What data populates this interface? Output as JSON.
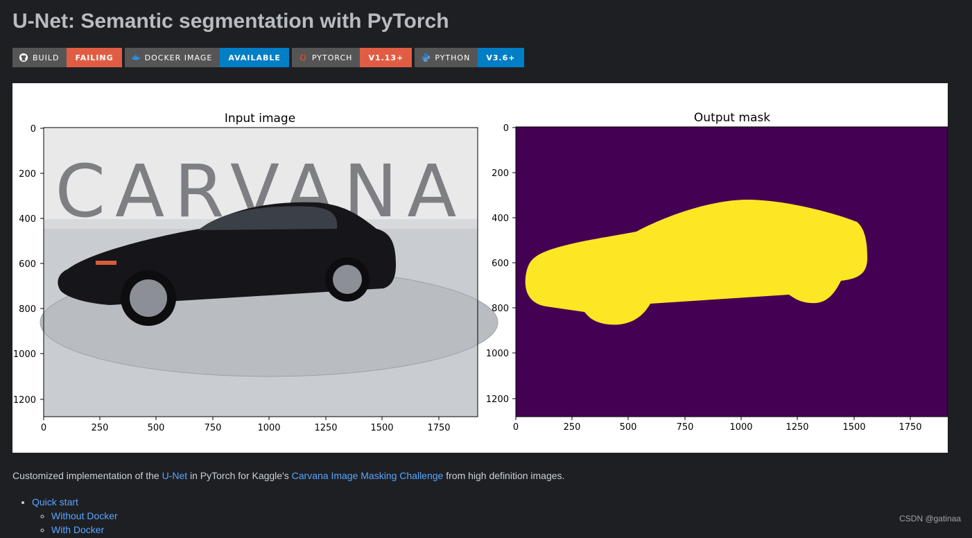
{
  "page": {
    "title": "U-Net: Semantic segmentation with PyTorch"
  },
  "badges": [
    {
      "label": "BUILD",
      "value": "FAILING",
      "icon": "github-icon",
      "color": "#e05d44"
    },
    {
      "label": "DOCKER IMAGE",
      "value": "AVAILABLE",
      "icon": "docker-icon",
      "color": "#007ec6"
    },
    {
      "label": "PYTORCH",
      "value": "V1.13+",
      "icon": "pytorch-icon",
      "color": "#e05d44"
    },
    {
      "label": "PYTHON",
      "value": "V3.6+",
      "icon": "python-icon",
      "color": "#007ec6"
    }
  ],
  "figure": {
    "left": {
      "title": "Input image",
      "watermark_text": "CARVANA",
      "xticks": [
        "0",
        "250",
        "500",
        "750",
        "1000",
        "1250",
        "1500",
        "1750"
      ],
      "yticks": [
        "0",
        "200",
        "400",
        "600",
        "800",
        "1000",
        "1200"
      ]
    },
    "right": {
      "title": "Output mask",
      "mask_color": "#fde725",
      "background_color": "#440154",
      "xticks": [
        "0",
        "250",
        "500",
        "750",
        "1000",
        "1250",
        "1500",
        "1750"
      ],
      "yticks": [
        "0",
        "200",
        "400",
        "600",
        "800",
        "1000",
        "1200"
      ]
    }
  },
  "description": {
    "before": "Customized implementation of the ",
    "link1": "U-Net",
    "middle": " in PyTorch for Kaggle's ",
    "link2": "Carvana Image Masking Challenge",
    "after": " from high definition images."
  },
  "toc": {
    "item1": "Quick start",
    "sub1": "Without Docker",
    "sub2": "With Docker"
  },
  "watermark": "CSDN @gatinaa"
}
